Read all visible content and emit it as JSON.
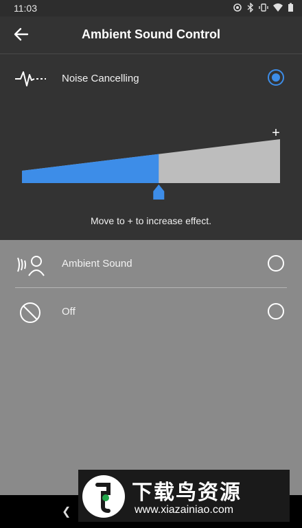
{
  "status_bar": {
    "time": "11:03",
    "icons": [
      "sync-icon",
      "bluetooth-icon",
      "vibrate-icon",
      "wifi-icon",
      "battery-icon"
    ]
  },
  "header": {
    "title": "Ambient Sound Control",
    "back_icon": "back-arrow-icon"
  },
  "options": [
    {
      "label": "Noise Cancelling",
      "icon": "noise-waveform-icon",
      "selected": true
    },
    {
      "label": "Ambient Sound",
      "icon": "ambient-person-icon",
      "selected": false
    },
    {
      "label": "Off",
      "icon": "off-circle-slash-icon",
      "selected": false
    }
  ],
  "slider": {
    "max_label": "+",
    "level": 0.53,
    "hint": "Move to + to increase effect."
  },
  "colors": {
    "accent": "#3d8de8",
    "panel": "#333333",
    "page": "#8a8a8a"
  },
  "watermark": {
    "title": "下载鸟资源",
    "url": "www.xiazainiao.com"
  }
}
